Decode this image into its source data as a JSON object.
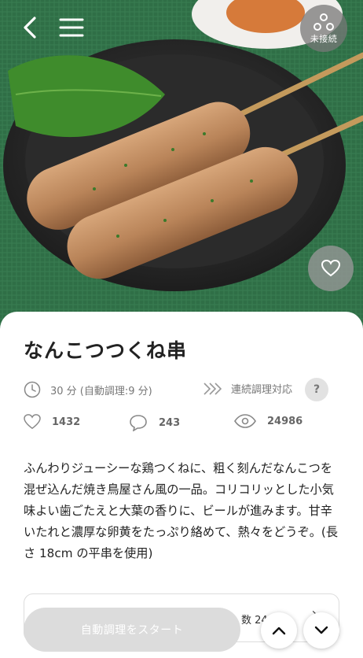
{
  "header": {
    "connection_status_label": "未接続",
    "icons": [
      "back-icon",
      "menu-icon",
      "connection-icon",
      "heart-icon"
    ]
  },
  "recipe": {
    "title": "なんこつつくね串",
    "time_text": "30 分 (自動調理:9 分)",
    "continuous_label": "連続調理対応",
    "help_label": "?",
    "likes": "1432",
    "comments": "243",
    "views": "24986",
    "description": "ふんわりジューシーな鶏つくねに、粗く刻んだなんこつを混ぜ込んだ焼き鳥屋さん風の一品。コリコリッとした小気味よい歯ごたえと大葉の香りに、ビールが進みます。甘辛いたれと濃厚な卵黄をたっぷり絡めて、熱々をどうぞ。(長さ 18cm の平串を使用)"
  },
  "servings": {
    "partial_label": "数 24"
  },
  "actions": {
    "start_label": "自動調理をスタート"
  },
  "colors": {
    "tablecloth": "#2f6e46",
    "button_disabled": "#dcdcdc"
  }
}
